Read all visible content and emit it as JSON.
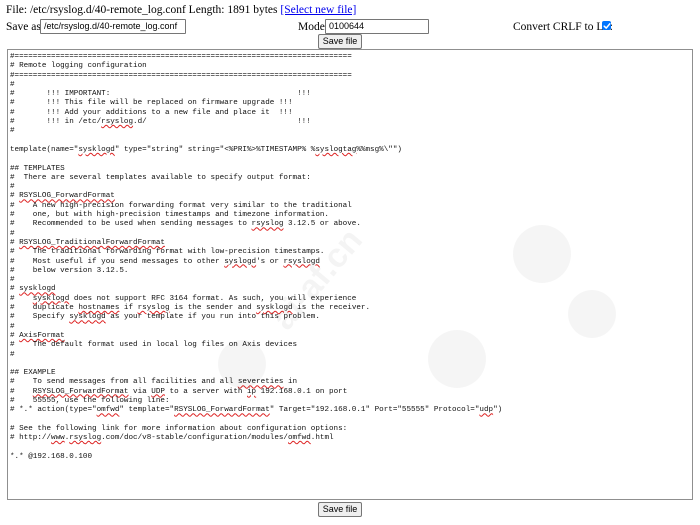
{
  "file_info": {
    "prefix": "File: /etc/rsyslog.d/40-remote_log.conf Length: 1891 bytes ",
    "select_link": "[Select new file]"
  },
  "form": {
    "save_as_label": "Save as:",
    "save_as_value": "/etc/rsyslog.d/40-remote_log.conf",
    "mode_label": "Mode:",
    "mode_value": "0100644",
    "crlf_label": "Convert CRLF to LF:",
    "crlf_checked": true
  },
  "buttons": {
    "save_top": "Save file",
    "save_bottom": "Save file"
  },
  "editor": {
    "lines": [
      "#==========================================================================",
      "# Remote logging configuration",
      "#==========================================================================",
      "#",
      "#       !!! IMPORTANT:                                         !!!",
      "#       !!! This file will be replaced on firmware upgrade !!!",
      "#       !!! Add your additions to a new file and place it  !!!",
      "#       !!! in /etc/rsyslog.d/                                 !!!",
      "#",
      "",
      "template(name=\"sysklogd\" type=\"string\" string=\"<%PRI%>%TIMESTAMP% %syslogtag%%msg%\\\"\")",
      "",
      "## TEMPLATES",
      "#  There are several templates available to specify output format:",
      "#",
      "# RSYSLOG_ForwardFormat",
      "#    A new high-precision forwarding format very similar to the traditional",
      "#    one, but with high-precision timestamps and timezone information.",
      "#    Recommended to be used when sending messages to rsyslog 3.12.5 or above.",
      "#",
      "# RSYSLOG_TraditionalForwardFormat",
      "#    The traditional forwarding format with low-precision timestamps.",
      "#    Most useful if you send messages to other syslogd's or rsyslogd",
      "#    below version 3.12.5.",
      "#",
      "# sysklogd",
      "#    sysklogd does not support RFC 3164 format. As such, you will experience",
      "#    duplicate hostnames if rsyslog is the sender and sysklogd is the receiver.",
      "#    Specify sysklogd as your template if you run into this problem.",
      "#",
      "# AxisFormat",
      "#    The default format used in local log files on Axis devices",
      "#",
      "",
      "## EXAMPLE",
      "#    To send messages from all facilities and all severeties in",
      "#    RSYSLOG_ForwardFormat via UDP to a server with ip 192.168.0.1 on port",
      "#    55555, use the following line:",
      "# *.* action(type=\"omfwd\" template=\"RSYSLOG_ForwardFormat\" Target=\"192.168.0.1\" Port=\"55555\" Protocol=\"udp\")",
      "",
      "# See the following link for more information about configuration options:",
      "# http://www.rsyslog.com/doc/v8-stable/configuration/modules/omfwd.html",
      "",
      "*.* @192.168.0.100"
    ]
  },
  "icons": {
    "checkbox": "checkmark-icon"
  },
  "colors": {
    "link": "#0000ee",
    "checkbox": "#0075ff",
    "spellcheck": "#dd2222"
  }
}
